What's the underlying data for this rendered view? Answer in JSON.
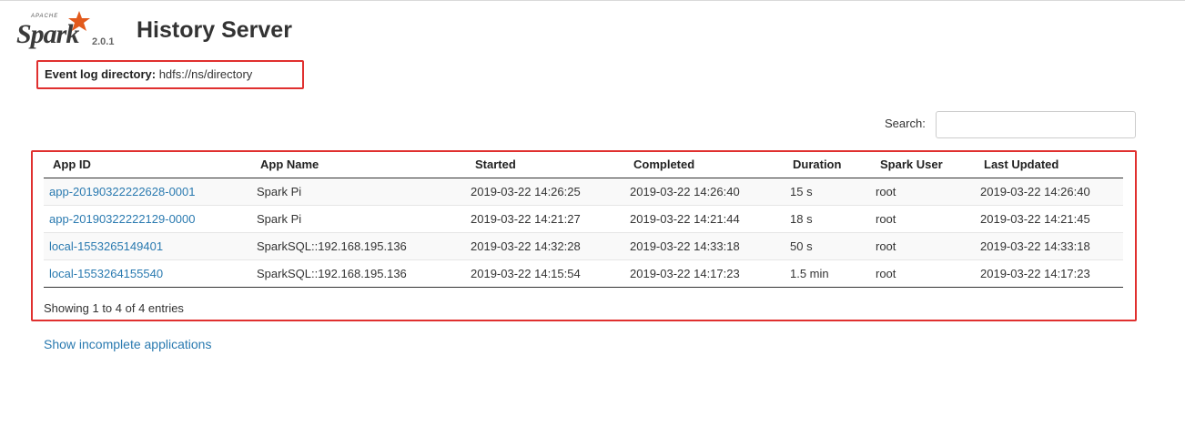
{
  "logo": {
    "apache": "APACHE",
    "spark": "Spark",
    "version": "2.0.1",
    "brand_color": "#e25a1c"
  },
  "header": {
    "title": "History Server"
  },
  "event_log": {
    "label": "Event log directory:",
    "value": "hdfs://ns/directory"
  },
  "search": {
    "label": "Search:",
    "value": ""
  },
  "table": {
    "columns": [
      "App ID",
      "App Name",
      "Started",
      "Completed",
      "Duration",
      "Spark User",
      "Last Updated"
    ],
    "rows": [
      [
        "app-20190322222628-0001",
        "Spark Pi",
        "2019-03-22 14:26:25",
        "2019-03-22 14:26:40",
        "15 s",
        "root",
        "2019-03-22 14:26:40"
      ],
      [
        "app-20190322222129-0000",
        "Spark Pi",
        "2019-03-22 14:21:27",
        "2019-03-22 14:21:44",
        "18 s",
        "root",
        "2019-03-22 14:21:45"
      ],
      [
        "local-1553265149401",
        "SparkSQL::192.168.195.136",
        "2019-03-22 14:32:28",
        "2019-03-22 14:33:18",
        "50 s",
        "root",
        "2019-03-22 14:33:18"
      ],
      [
        "local-1553264155540",
        "SparkSQL::192.168.195.136",
        "2019-03-22 14:15:54",
        "2019-03-22 14:17:23",
        "1.5 min",
        "root",
        "2019-03-22 14:17:23"
      ]
    ],
    "info": "Showing 1 to 4 of 4 entries"
  },
  "footer": {
    "incomplete_link": "Show incomplete applications"
  },
  "colors": {
    "link": "#2a7ab0",
    "highlight": "#e0302f"
  }
}
